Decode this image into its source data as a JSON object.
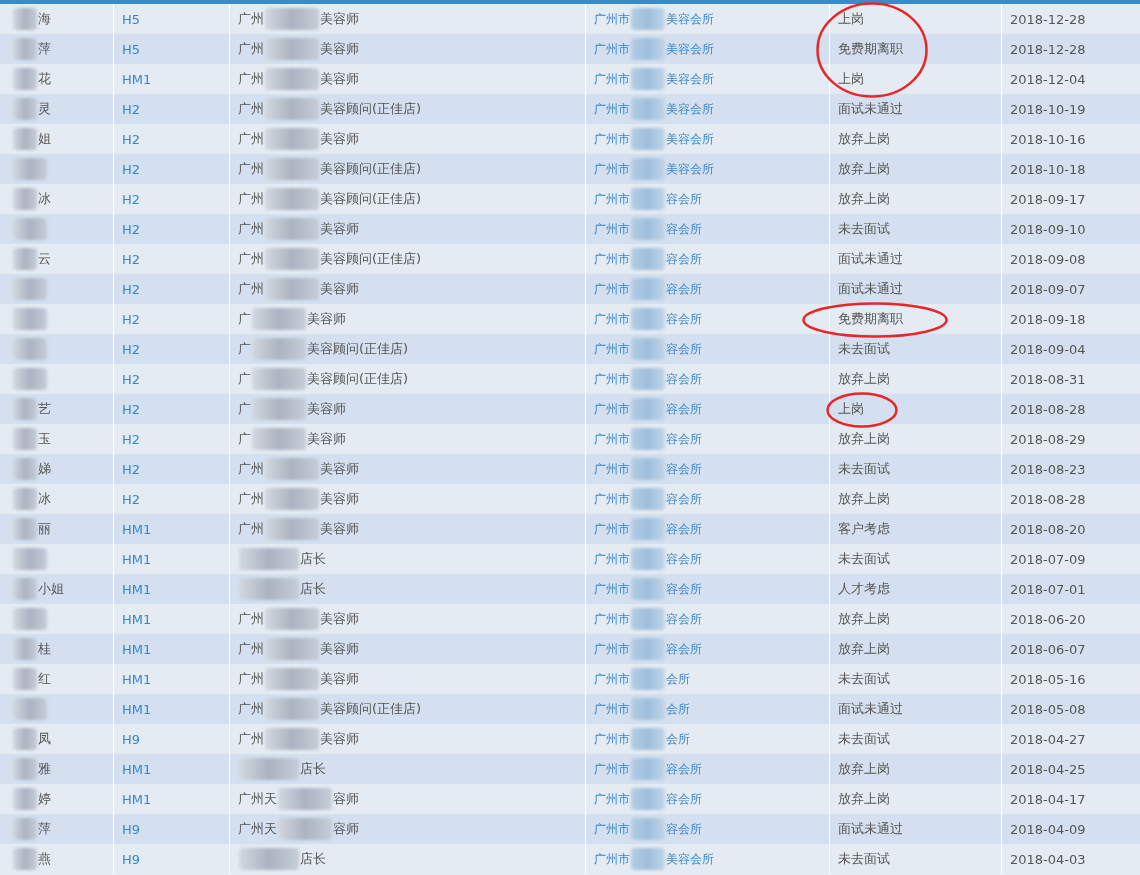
{
  "table": {
    "rows": [
      {
        "name": "海",
        "code": "H5",
        "title_prefix": "广州",
        "title": "美容师",
        "company_prefix": "广州市",
        "company": "美容会所",
        "status": "上岗",
        "date": "2018-12-28",
        "circled": true
      },
      {
        "name": "萍",
        "code": "H5",
        "title_prefix": "广州",
        "title": "美容师",
        "company_prefix": "广州市",
        "company": "美容会所",
        "status": "免费期离职",
        "date": "2018-12-28",
        "circled": true
      },
      {
        "name": "花",
        "code": "HM1",
        "title_prefix": "广州",
        "title": "美容师",
        "company_prefix": "广州市",
        "company": "美容会所",
        "status": "上岗",
        "date": "2018-12-04",
        "circled": true
      },
      {
        "name": "灵",
        "code": "H2",
        "title_prefix": "广州",
        "title": "美容顾问(正佳店)",
        "company_prefix": "广州市",
        "company": "美容会所",
        "status": "面试未通过",
        "date": "2018-10-19",
        "circled": false
      },
      {
        "name": "姐",
        "code": "H2",
        "title_prefix": "广州",
        "title": "美容师",
        "company_prefix": "广州市",
        "company": "美容会所",
        "status": "放弃上岗",
        "date": "2018-10-16",
        "circled": false
      },
      {
        "code": "H2",
        "title_prefix": "广州",
        "title": "美容顾问(正佳店)",
        "company_prefix": "广州市",
        "company": "美容会所",
        "status": "放弃上岗",
        "date": "2018-10-18",
        "circled": false
      },
      {
        "name": "冰",
        "code": "H2",
        "title_prefix": "广州",
        "title": "美容顾问(正佳店)",
        "company_prefix": "广州市",
        "company": "容会所",
        "status": "放弃上岗",
        "date": "2018-09-17",
        "circled": false
      },
      {
        "code": "H2",
        "title_prefix": "广州",
        "title": "美容师",
        "company_prefix": "广州市",
        "company": "容会所",
        "status": "未去面试",
        "date": "2018-09-10",
        "circled": false
      },
      {
        "name": "云",
        "code": "H2",
        "title_prefix": "广州",
        "title": "美容顾问(正佳店)",
        "company_prefix": "广州市",
        "company": "容会所",
        "status": "面试未通过",
        "date": "2018-09-08",
        "circled": false
      },
      {
        "code": "H2",
        "title_prefix": "广州",
        "title": "美容师",
        "company_prefix": "广州市",
        "company": "容会所",
        "status": "面试未通过",
        "date": "2018-09-07",
        "circled": false
      },
      {
        "code": "H2",
        "title_prefix": "广",
        "title": "美容师",
        "company_prefix": "广州市",
        "company": "容会所",
        "status": "免费期离职",
        "date": "2018-09-18",
        "circled": true
      },
      {
        "code": "H2",
        "title_prefix": "广",
        "title": "美容顾问(正佳店)",
        "company_prefix": "广州市",
        "company": "容会所",
        "status": "未去面试",
        "date": "2018-09-04",
        "circled": false
      },
      {
        "code": "H2",
        "title_prefix": "广",
        "title": "美容顾问(正佳店)",
        "company_prefix": "广州市",
        "company": "容会所",
        "status": "放弃上岗",
        "date": "2018-08-31",
        "circled": false
      },
      {
        "name": "艺",
        "code": "H2",
        "title_prefix": "广",
        "title": "美容师",
        "company_prefix": "广州市",
        "company": "容会所",
        "status": "上岗",
        "date": "2018-08-28",
        "circled": true
      },
      {
        "name": "玉",
        "code": "H2",
        "title_prefix": "广",
        "title": "美容师",
        "company_prefix": "广州市",
        "company": "容会所",
        "status": "放弃上岗",
        "date": "2018-08-29",
        "circled": false
      },
      {
        "name": "娣",
        "code": "H2",
        "title_prefix": "广州",
        "title": "美容师",
        "company_prefix": "广州市",
        "company": "容会所",
        "status": "未去面试",
        "date": "2018-08-23",
        "circled": false
      },
      {
        "name": "冰",
        "code": "H2",
        "title_prefix": "广州",
        "title": "美容师",
        "company_prefix": "广州市",
        "company": "容会所",
        "status": "放弃上岗",
        "date": "2018-08-28",
        "circled": false
      },
      {
        "name": "丽",
        "code": "HM1",
        "title_prefix": "广州",
        "title": "美容师",
        "company_prefix": "广州市",
        "company": "容会所",
        "status": "客户考虑",
        "date": "2018-08-20",
        "circled": false
      },
      {
        "code": "HM1",
        "title": "店长",
        "company_prefix": "广州市",
        "company": "容会所",
        "status": "未去面试",
        "date": "2018-07-09",
        "circled": false
      },
      {
        "name": "小姐",
        "code": "HM1",
        "title": "店长",
        "company_prefix": "广州市",
        "company": "容会所",
        "status": "人才考虑",
        "date": "2018-07-01",
        "circled": false
      },
      {
        "code": "HM1",
        "title_prefix": "广州",
        "title": "美容师",
        "company_prefix": "广州市",
        "company": "容会所",
        "status": "放弃上岗",
        "date": "2018-06-20",
        "circled": false
      },
      {
        "name": "桂",
        "code": "HM1",
        "title_prefix": "广州",
        "title": "美容师",
        "company_prefix": "广州市",
        "company": "容会所",
        "status": "放弃上岗",
        "date": "2018-06-07",
        "circled": false
      },
      {
        "name": "红",
        "code": "HM1",
        "title_prefix": "广州",
        "title": "美容师",
        "company_prefix": "广州市",
        "company": "会所",
        "status": "未去面试",
        "date": "2018-05-16",
        "circled": false
      },
      {
        "code": "HM1",
        "title_prefix": "广州",
        "title": "美容顾问(正佳店)",
        "company_prefix": "广州市",
        "company": "会所",
        "status": "面试未通过",
        "date": "2018-05-08",
        "circled": false
      },
      {
        "name": "凤",
        "code": "H9",
        "title_prefix": "广州",
        "title": "美容师",
        "company_prefix": "广州市",
        "company": "会所",
        "status": "未去面试",
        "date": "2018-04-27",
        "circled": false
      },
      {
        "name": "雅",
        "code": "HM1",
        "title": "店长",
        "company_prefix": "广州市",
        "company": "容会所",
        "status": "放弃上岗",
        "date": "2018-04-25",
        "circled": false
      },
      {
        "name": "婷",
        "code": "HM1",
        "title_prefix": "广州天",
        "title": "容师",
        "company_prefix": "广州市",
        "company": "容会所",
        "status": "放弃上岗",
        "date": "2018-04-17",
        "circled": false
      },
      {
        "name": "萍",
        "code": "H9",
        "title_prefix": "广州天",
        "title": "容师",
        "company_prefix": "广州市",
        "company": "容会所",
        "status": "面试未通过",
        "date": "2018-04-09",
        "circled": false
      },
      {
        "name": "燕",
        "code": "H9",
        "title": "店长",
        "company_prefix": "广州市",
        "company": "美容会所",
        "status": "未去面试",
        "date": "2018-04-03",
        "circled": false
      }
    ]
  }
}
